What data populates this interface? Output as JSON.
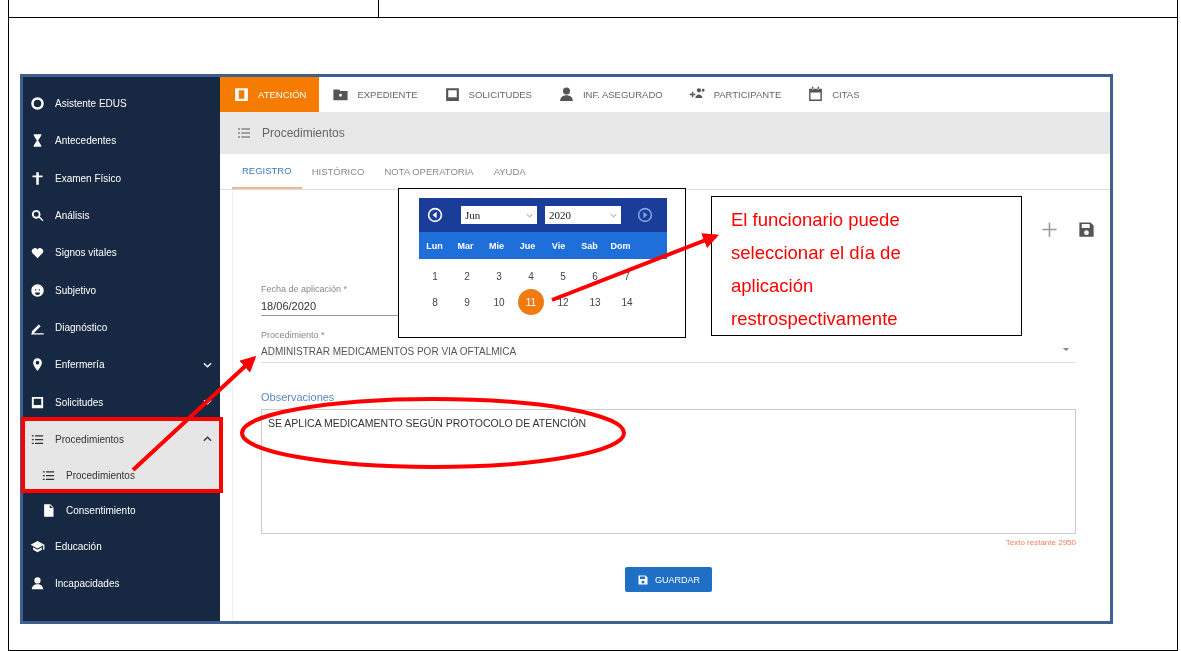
{
  "top_tabs": [
    {
      "label": "ATENCIÓN",
      "selected": true
    },
    {
      "label": "EXPEDIENTE",
      "selected": false
    },
    {
      "label": "SOLICITUDES",
      "selected": false
    },
    {
      "label": "INF. ASEGURADO",
      "selected": false
    },
    {
      "label": "PARTICIPANTE",
      "selected": false
    },
    {
      "label": "CITAS",
      "selected": false
    }
  ],
  "sidebar": {
    "items": [
      {
        "kind": "link",
        "label": "Asistente EDUS",
        "selected": false
      },
      {
        "kind": "link",
        "label": "Antecedentes",
        "selected": false
      },
      {
        "kind": "link",
        "label": "Examen Físico",
        "selected": false
      },
      {
        "kind": "link",
        "label": "Análisis",
        "selected": false
      },
      {
        "kind": "link",
        "label": "Signos vitales",
        "selected": false
      },
      {
        "kind": "link",
        "label": "Subjetivo",
        "selected": false
      },
      {
        "kind": "link",
        "label": "Diagnóstico",
        "selected": false
      },
      {
        "kind": "group",
        "label": "Enfermería",
        "selected": false,
        "expanded": false
      },
      {
        "kind": "group",
        "label": "Solicitudes",
        "selected": false,
        "expanded": false
      },
      {
        "kind": "group",
        "label": "Procedimientos",
        "selected": true,
        "expanded": true,
        "children": [
          {
            "label": "Procedimientos",
            "selected": true
          },
          {
            "label": "Consentimiento",
            "selected": false
          }
        ]
      },
      {
        "kind": "link",
        "label": "Educación",
        "selected": false
      },
      {
        "kind": "link",
        "label": "Incapacidades",
        "selected": false
      }
    ]
  },
  "section_title": "Procedimientos",
  "sub_tabs": [
    {
      "label": "REGISTRO",
      "selected": true
    },
    {
      "label": "HISTÓRICO",
      "selected": false
    },
    {
      "label": "NOTA OPERATORIA",
      "selected": false
    },
    {
      "label": "AYUDA",
      "selected": false
    }
  ],
  "form": {
    "date_field": {
      "label": "Fecha de aplicación *",
      "value": "18/06/2020"
    },
    "procedure_field": {
      "label": "Procedimiento *",
      "value": "ADMINISTRAR MEDICAMENTOS POR VIA OFTALMICA"
    },
    "observations": {
      "label": "Observaciones",
      "value": "SE APLICA MEDICAMENTO SEGÚN PROTOCOLO DE ATENCIÓN",
      "counter": "Texto restante 2950"
    },
    "save_button": "GUARDAR"
  },
  "calendar": {
    "month": "Jun",
    "year": "2020",
    "weekdays": [
      "Lun",
      "Mar",
      "Mie",
      "Jue",
      "Vie",
      "Sab",
      "Dom"
    ],
    "days": [
      {
        "label": "1",
        "selected": false
      },
      {
        "label": "2",
        "selected": false
      },
      {
        "label": "3",
        "selected": false
      },
      {
        "label": "4",
        "selected": false
      },
      {
        "label": "5",
        "selected": false
      },
      {
        "label": "6",
        "selected": false
      },
      {
        "label": "7",
        "selected": false
      },
      {
        "label": "8",
        "selected": false
      },
      {
        "label": "9",
        "selected": false
      },
      {
        "label": "10",
        "selected": false
      },
      {
        "label": "11",
        "selected": true
      },
      {
        "label": "12",
        "selected": false
      },
      {
        "label": "13",
        "selected": false
      },
      {
        "label": "14",
        "selected": false
      }
    ]
  },
  "callout": "El funcionario puede seleccionar el día de aplicación restrospectivamente"
}
